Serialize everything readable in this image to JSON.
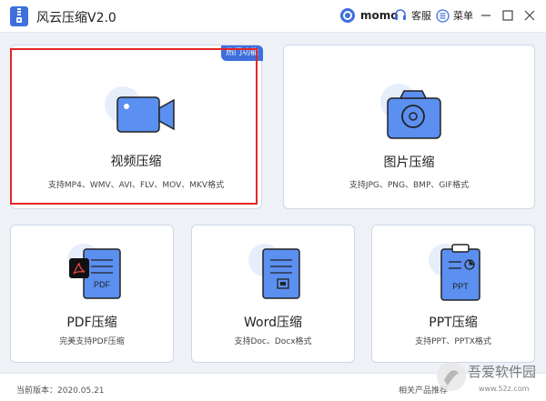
{
  "window": {
    "title": "风云压缩V2.0",
    "user_name": "momo",
    "service_label": "客服",
    "menu_label": "菜单"
  },
  "cards": {
    "video": {
      "title": "视频压缩",
      "desc": "支持MP4、WMV、AVI、FLV、MOV、MKV格式",
      "badge": "热门功能"
    },
    "image": {
      "title": "图片压缩",
      "desc": "支持JPG、PNG、BMP、GIF格式"
    },
    "pdf": {
      "title": "PDF压缩",
      "desc": "完美支持PDF压缩",
      "icon_text": "PDF"
    },
    "word": {
      "title": "Word压缩",
      "desc": "支持Doc、Docx格式"
    },
    "ppt": {
      "title": "PPT压缩",
      "desc": "支持PPT、PPTX格式",
      "icon_text": "PPT"
    }
  },
  "footer": {
    "version": "当前版本：2020.05.21",
    "related": "相关产品推荐"
  },
  "watermark": {
    "name": "吾爱软件园",
    "url": "www.52z.com"
  },
  "colors": {
    "accent": "#3e6fdc",
    "icon_blue": "#5b8ff0",
    "highlight": "#e42626",
    "background": "#eef1f6"
  }
}
